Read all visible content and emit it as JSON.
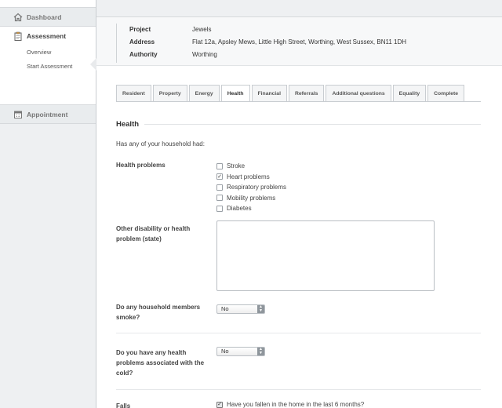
{
  "sidebar": {
    "dashboard": "Dashboard",
    "assessment": "Assessment",
    "overview": "Overview",
    "start_assessment": "Start Assessment",
    "appointment": "Appointment"
  },
  "header": {
    "project_label": "Project",
    "project_value": "Jewels",
    "address_label": "Address",
    "address_value": "Flat 12a, Apsley Mews, Little High Street, Worthing, West Sussex, BN11 1DH",
    "authority_label": "Authority",
    "authority_value": "Worthing"
  },
  "tabs": [
    "Resident",
    "Property",
    "Energy",
    "Health",
    "Financial",
    "Referrals",
    "Additional questions",
    "Equality",
    "Complete"
  ],
  "active_tab": "Health",
  "form": {
    "section_title": "Health",
    "intro": "Has any of your household had:",
    "health_problems_label": "Health problems",
    "health_problems": [
      {
        "label": "Stroke",
        "checked": false
      },
      {
        "label": "Heart problems",
        "checked": true
      },
      {
        "label": "Respiratory problems",
        "checked": false
      },
      {
        "label": "Mobility problems",
        "checked": false
      },
      {
        "label": "Diabetes",
        "checked": false
      }
    ],
    "other_disability_label": "Other disability or health problem (state)",
    "other_disability_value": "",
    "smoke_label": "Do any household members smoke?",
    "smoke_value": "No",
    "cold_label": "Do you have any health problems associated with the cold?",
    "cold_value": "No",
    "falls_label": "Falls",
    "falls_question": "Have you fallen in the home in the last 6 months?",
    "falls_checked": true
  }
}
